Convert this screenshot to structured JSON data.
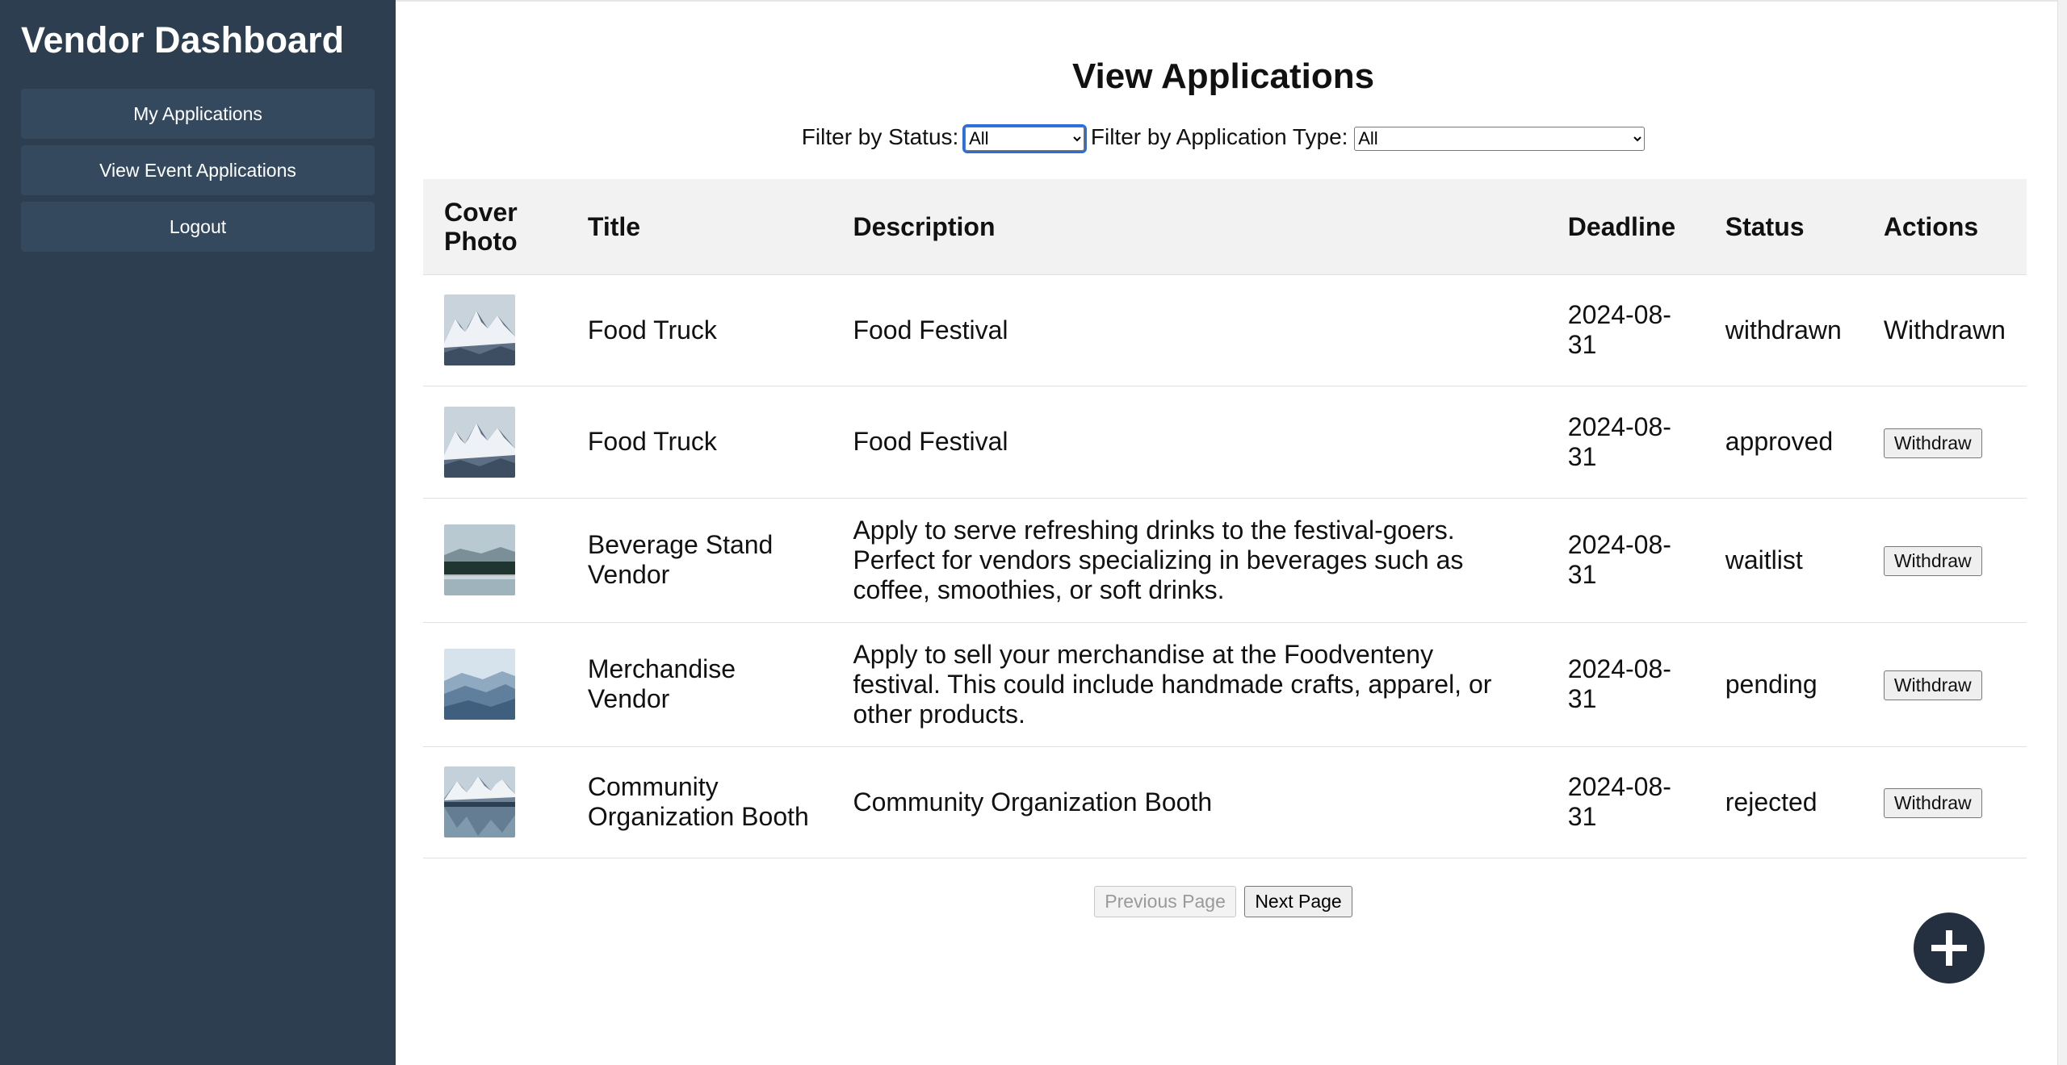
{
  "sidebar": {
    "title": "Vendor Dashboard",
    "items": [
      {
        "label": "My Applications"
      },
      {
        "label": "View Event Applications"
      },
      {
        "label": "Logout"
      }
    ]
  },
  "main": {
    "title": "View Applications",
    "filters": {
      "status_label": "Filter by Status:",
      "status_value": "All",
      "type_label": "Filter by Application Type:",
      "type_value": "All"
    },
    "table": {
      "headers": [
        "Cover Photo",
        "Title",
        "Description",
        "Deadline",
        "Status",
        "Actions"
      ],
      "rows": [
        {
          "thumb": "snowy-mountains",
          "title": "Food Truck",
          "description": "Food Festival",
          "deadline": "2024-08-31",
          "status": "withdrawn",
          "action": "Withdrawn",
          "action_type": "text"
        },
        {
          "thumb": "snowy-mountains",
          "title": "Food Truck",
          "description": "Food Festival",
          "deadline": "2024-08-31",
          "status": "approved",
          "action": "Withdraw",
          "action_type": "button"
        },
        {
          "thumb": "misty-forest-lake",
          "title": "Beverage Stand Vendor",
          "description": "Apply to serve refreshing drinks to the festival-goers. Perfect for vendors specializing in beverages such as coffee, smoothies, or soft drinks.",
          "deadline": "2024-08-31",
          "status": "waitlist",
          "action": "Withdraw",
          "action_type": "button"
        },
        {
          "thumb": "blue-misty-hills",
          "title": "Merchandise Vendor",
          "description": "Apply to sell your merchandise at the Foodventeny festival. This could include handmade crafts, apparel, or other products.",
          "deadline": "2024-08-31",
          "status": "pending",
          "action": "Withdraw",
          "action_type": "button"
        },
        {
          "thumb": "mountain-lake-reflection",
          "title": "Community Organization Booth",
          "description": "Community Organization Booth",
          "deadline": "2024-08-31",
          "status": "rejected",
          "action": "Withdraw",
          "action_type": "button"
        }
      ]
    },
    "pagination": {
      "previous": "Previous Page",
      "next": "Next Page"
    },
    "fab": {
      "icon": "plus-icon"
    }
  },
  "colors": {
    "sidebar_bg": "#2c3e50",
    "nav_item_bg": "#34495e",
    "fab_bg": "#243040",
    "header_row_bg": "#f2f2f2"
  }
}
